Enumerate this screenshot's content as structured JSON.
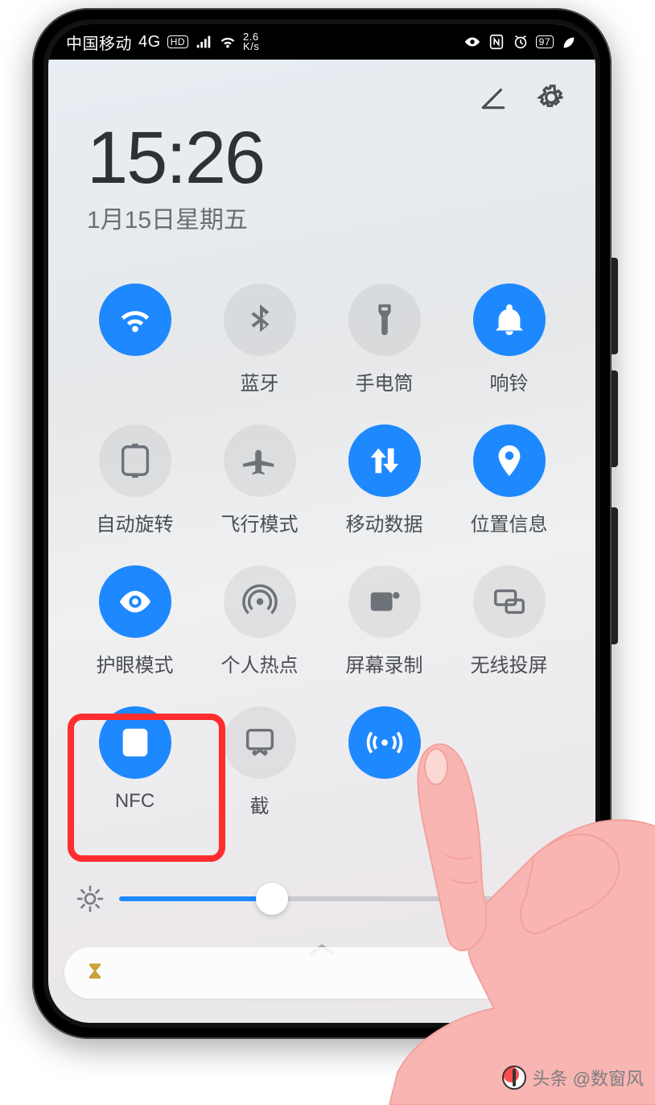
{
  "statusbar": {
    "carrier": "中国移动",
    "network": "4G",
    "hd": "HD",
    "speed_top": "2.6",
    "speed_bot": "K/s",
    "battery": "97"
  },
  "header": {
    "time": "15:26",
    "date": "1月15日星期五"
  },
  "tiles": [
    {
      "id": "wifi",
      "label": "",
      "icon": "wifi",
      "on": true
    },
    {
      "id": "bluetooth",
      "label": "蓝牙",
      "icon": "bluetooth",
      "on": false
    },
    {
      "id": "flashlight",
      "label": "手电筒",
      "icon": "flashlight",
      "on": false
    },
    {
      "id": "ring",
      "label": "响铃",
      "icon": "bell",
      "on": true
    },
    {
      "id": "rotate",
      "label": "自动旋转",
      "icon": "rotate",
      "on": false
    },
    {
      "id": "airplane",
      "label": "飞行模式",
      "icon": "airplane",
      "on": false
    },
    {
      "id": "data",
      "label": "移动数据",
      "icon": "data",
      "on": true
    },
    {
      "id": "location",
      "label": "位置信息",
      "icon": "location",
      "on": true
    },
    {
      "id": "eyecare",
      "label": "护眼模式",
      "icon": "eye",
      "on": true
    },
    {
      "id": "hotspot",
      "label": "个人热点",
      "icon": "hotspot",
      "on": false
    },
    {
      "id": "record",
      "label": "屏幕录制",
      "icon": "record",
      "on": false
    },
    {
      "id": "cast",
      "label": "无线投屏",
      "icon": "cast",
      "on": false
    },
    {
      "id": "nfc",
      "label": "NFC",
      "icon": "nfc",
      "on": true
    },
    {
      "id": "snip",
      "label": "截",
      "icon": "snip",
      "on": false
    },
    {
      "id": "huaweishare",
      "label": "",
      "icon": "share",
      "on": true
    },
    {
      "id": "blank",
      "label": "",
      "icon": "",
      "on": false,
      "hidden": true
    }
  ],
  "brightness": {
    "percent": 34
  },
  "watermark": {
    "text": "头条 @数窗风"
  }
}
